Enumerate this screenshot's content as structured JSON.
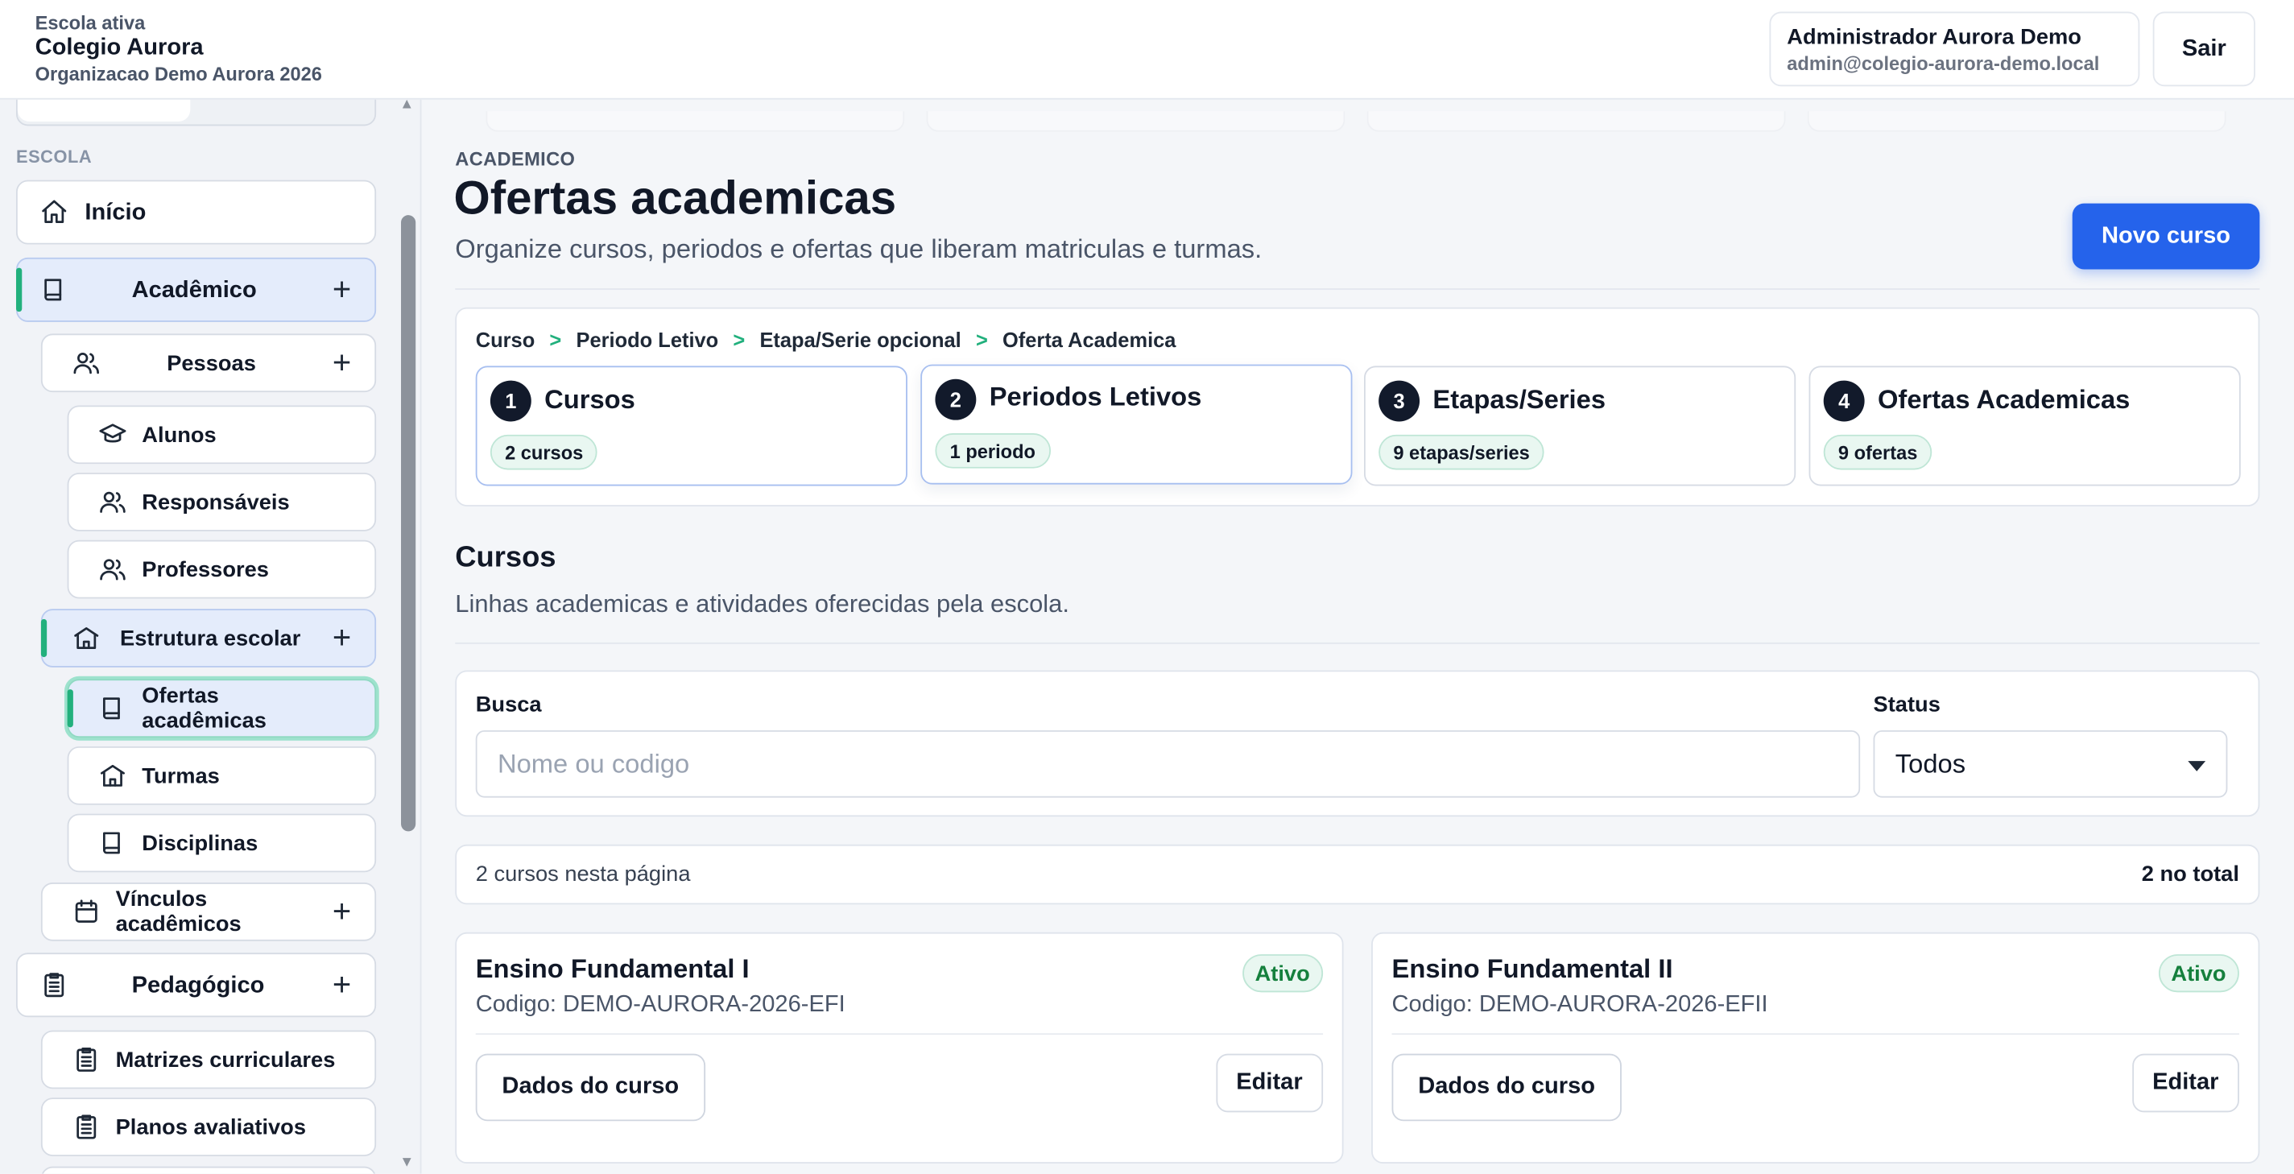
{
  "header": {
    "school_label": "Escola ativa",
    "school_name": "Colegio Aurora",
    "org_name": "Organizacao Demo Aurora 2026",
    "user_name": "Administrador Aurora Demo",
    "user_email": "admin@colegio-aurora-demo.local",
    "logout_label": "Sair"
  },
  "sidebar": {
    "section_label": "ESCOLA",
    "items": [
      {
        "label": "Início",
        "icon": "home-icon"
      },
      {
        "label": "Acadêmico",
        "icon": "book-icon",
        "expand": "+"
      },
      {
        "label": "Pessoas",
        "icon": "users-icon",
        "expand": "+"
      },
      {
        "label": "Alunos",
        "icon": "graduation-cap-icon"
      },
      {
        "label": "Responsáveis",
        "icon": "users-icon"
      },
      {
        "label": "Professores",
        "icon": "users-icon"
      },
      {
        "label": "Estrutura escolar",
        "icon": "school-icon",
        "expand": "+"
      },
      {
        "label": "Ofertas acadêmicas",
        "icon": "book-icon"
      },
      {
        "label": "Turmas",
        "icon": "school-icon"
      },
      {
        "label": "Disciplinas",
        "icon": "book-icon"
      },
      {
        "label": "Vínculos acadêmicos",
        "icon": "calendar-icon",
        "expand": "+"
      },
      {
        "label": "Pedagógico",
        "icon": "clipboard-icon",
        "expand": "+"
      },
      {
        "label": "Matrizes curriculares",
        "icon": "clipboard-icon"
      },
      {
        "label": "Planos avaliativos",
        "icon": "clipboard-icon"
      }
    ]
  },
  "page": {
    "eyebrow": "ACADEMICO",
    "title": "Ofertas academicas",
    "description": "Organize cursos, periodos e ofertas que liberam matriculas e turmas.",
    "new_button": "Novo curso"
  },
  "flow": {
    "breadcrumb": [
      "Curso",
      ">",
      "Periodo Letivo",
      ">",
      "Etapa/Serie opcional",
      ">",
      "Oferta Academica"
    ],
    "steps": [
      {
        "num": "1",
        "title": "Cursos",
        "count": "2 cursos"
      },
      {
        "num": "2",
        "title": "Periodos Letivos",
        "count": "1 periodo"
      },
      {
        "num": "3",
        "title": "Etapas/Series",
        "count": "9 etapas/series"
      },
      {
        "num": "4",
        "title": "Ofertas Academicas",
        "count": "9 ofertas"
      }
    ]
  },
  "courses_section": {
    "title": "Cursos",
    "description": "Linhas academicas e atividades oferecidas pela escola.",
    "search_label": "Busca",
    "search_placeholder": "Nome ou codigo",
    "search_value": "",
    "status_label": "Status",
    "status_value": "Todos",
    "page_count": "2 cursos nesta página",
    "total_count": "2 no total"
  },
  "courses": [
    {
      "name": "Ensino Fundamental I",
      "code": "Codigo: DEMO-AURORA-2026-EFI",
      "status": "Ativo",
      "details_label": "Dados do curso",
      "edit_label": "Editar"
    },
    {
      "name": "Ensino Fundamental II",
      "code": "Codigo: DEMO-AURORA-2026-EFII",
      "status": "Ativo",
      "details_label": "Dados do curso",
      "edit_label": "Editar"
    }
  ],
  "colors": {
    "primary": "#2563eb",
    "accent_green": "#22b07d",
    "active_bg": "#e4ecfb",
    "badge_text": "#15803d"
  }
}
